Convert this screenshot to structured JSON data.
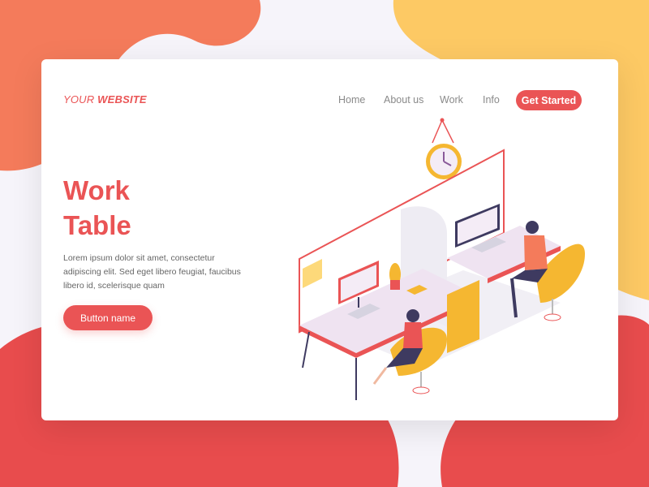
{
  "colors": {
    "accent": "#ea5455",
    "blob_orange": "#f47b5b",
    "blob_yellow": "#fdc964",
    "blob_red": "#e84c4d",
    "chair": "#f5b731"
  },
  "header": {
    "logo_prefix": "YOUR",
    "logo_bold": "WEBSITE",
    "nav": [
      "Home",
      "About us",
      "Work",
      "Info"
    ],
    "cta_label": "Get Started"
  },
  "hero": {
    "title_line1": "Work",
    "title_line2": "Table",
    "description": "Lorem ipsum dolor sit amet, consectetur adipiscing elit. Sed eget libero feugiat, faucibus libero id, scelerisque quam",
    "button_label": "Button name"
  },
  "illustration": {
    "icon": "office-workspace-illustration"
  }
}
